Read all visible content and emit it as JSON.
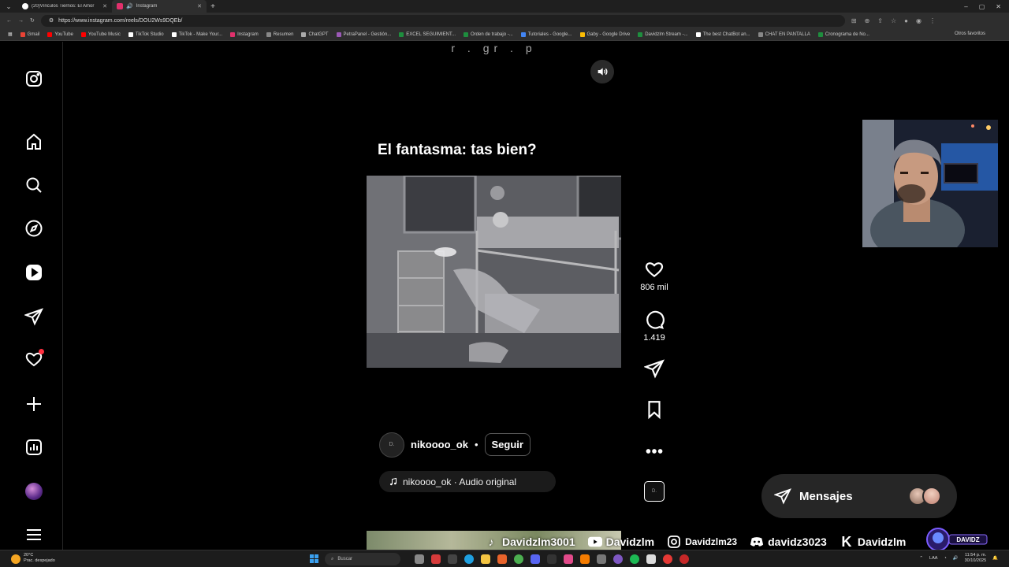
{
  "browser": {
    "tabs": [
      {
        "title": "(20)Vínculos Tiernos: El Amor entre...",
        "active": false
      },
      {
        "title": "Instagram",
        "active": true
      }
    ],
    "url": "https://www.instagram.com/reels/DOU2Ws9DQEb/",
    "bookmarks": [
      "Gmail",
      "YouTube",
      "YouTube Music",
      "TikTok Studio",
      "TikTok - Make Your...",
      "Instagram",
      "Resumen",
      "ChatGPT",
      "PetraPanel - Gestión...",
      "EXCEL SEGUIMIENT...",
      "Orden de trabajo -...",
      "Tutoriales - Google...",
      "Gaby - Google Drive",
      "Davidzlm Stream -...",
      "The best ChatBot an...",
      "CHAT EN PANTALLA",
      "Cronograma de No..."
    ],
    "other_bookmarks": "Otros favoritos"
  },
  "sidebar": {
    "items": [
      "instagram-logo",
      "home",
      "search",
      "explore",
      "reels",
      "messages",
      "notifications",
      "create",
      "dashboard",
      "profile",
      "more"
    ]
  },
  "reel": {
    "top_text": "r . gr . p",
    "caption": "El fantasma: tas bien?",
    "author": "nikoooo_ok",
    "author_avatar_text": "D.",
    "separator": "•",
    "follow_label": "Seguir",
    "audio": "nikoooo_ok · Audio original",
    "likes": "806 mil",
    "comments": "1.419"
  },
  "messages": {
    "label": "Mensajes"
  },
  "socials": [
    {
      "platform": "tiktok",
      "handle": "Davidzlm3001"
    },
    {
      "platform": "youtube",
      "handle": "Davidzlm"
    },
    {
      "platform": "instagram",
      "handle": "Davidzlm23"
    },
    {
      "platform": "discord",
      "handle": "davidz3023"
    },
    {
      "platform": "kick",
      "handle": "Davidzlm"
    }
  ],
  "brand_badge": "DAVIDZ",
  "taskbar": {
    "weather_temp": "20°C",
    "weather_desc": "Prac. despejado",
    "search_placeholder": "Buscar",
    "lang": "LAA",
    "time": "11:54 p. m.",
    "date": "30/10/2025"
  },
  "colors": {
    "background": "#000000",
    "accent_notification": "#ff3040",
    "pill": "#1b1b1b"
  }
}
